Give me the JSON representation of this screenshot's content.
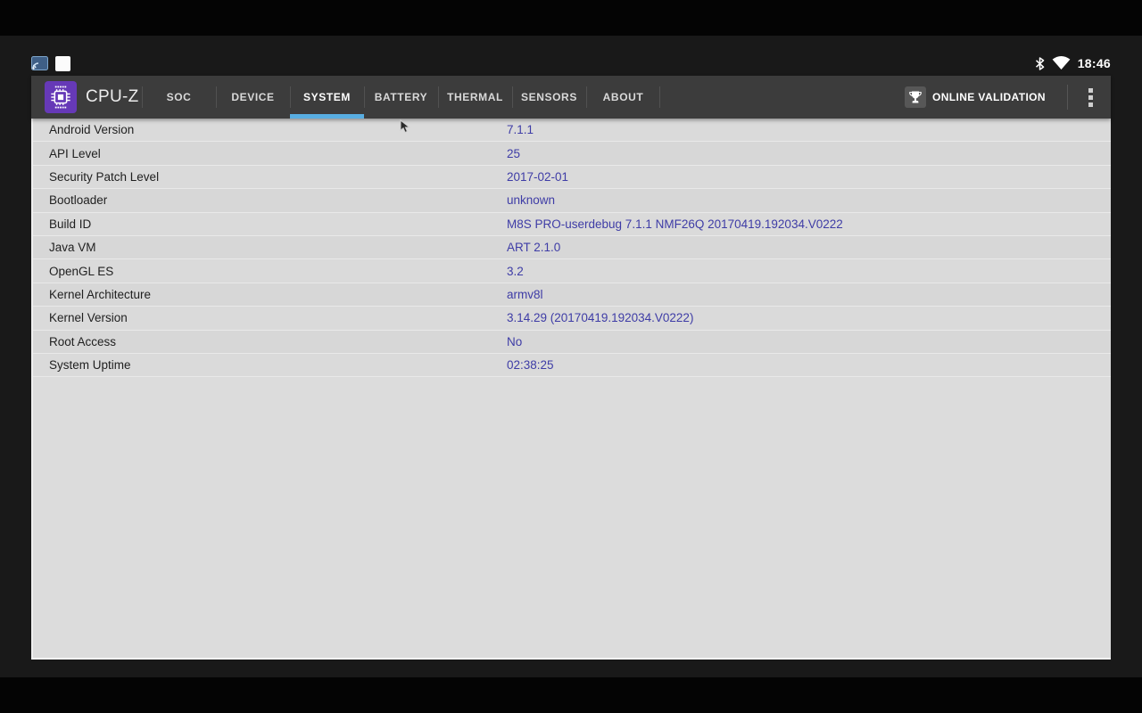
{
  "colors": {
    "accent": "#58ade1",
    "value_text": "#3e3ca6",
    "label_text": "#1f1f1f",
    "appbar_bg": "#3c3c3c",
    "content_bg": "#dcdcdc",
    "logo_bg": "#6639b7",
    "screen_bg": "#191919"
  },
  "status_bar": {
    "time": "18:46",
    "left_icons": [
      "cast-icon",
      "app-square-icon"
    ],
    "right_icons": [
      "bluetooth-icon",
      "wifi-icon"
    ]
  },
  "app_bar": {
    "title": "CPU-Z",
    "tabs": [
      {
        "label": "SOC",
        "active": false
      },
      {
        "label": "DEVICE",
        "active": false
      },
      {
        "label": "SYSTEM",
        "active": true
      },
      {
        "label": "BATTERY",
        "active": false
      },
      {
        "label": "THERMAL",
        "active": false
      },
      {
        "label": "SENSORS",
        "active": false
      },
      {
        "label": "ABOUT",
        "active": false
      }
    ],
    "online_validation": {
      "label": "ONLINE VALIDATION",
      "icon": "trophy-icon"
    },
    "overflow_icon": "overflow-menu-icon"
  },
  "system_info": {
    "rows": [
      {
        "label": "Android Version",
        "value": "7.1.1"
      },
      {
        "label": "API Level",
        "value": "25"
      },
      {
        "label": "Security Patch Level",
        "value": "2017-02-01"
      },
      {
        "label": "Bootloader",
        "value": "unknown"
      },
      {
        "label": "Build ID",
        "value": "M8S PRO-userdebug 7.1.1 NMF26Q 20170419.192034.V0222"
      },
      {
        "label": "Java VM",
        "value": "ART 2.1.0"
      },
      {
        "label": "OpenGL ES",
        "value": "3.2"
      },
      {
        "label": "Kernel Architecture",
        "value": "armv8l"
      },
      {
        "label": "Kernel Version",
        "value": "3.14.29 (20170419.192034.V0222)"
      },
      {
        "label": "Root Access",
        "value": "No"
      },
      {
        "label": "System Uptime",
        "value": "02:38:25"
      }
    ]
  }
}
